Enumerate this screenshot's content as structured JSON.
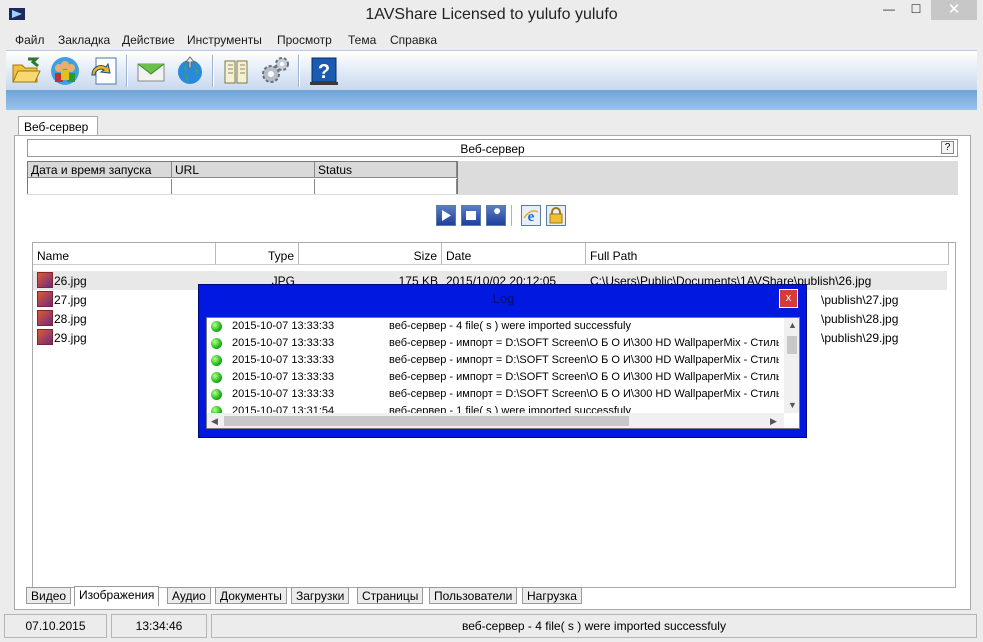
{
  "window": {
    "title": "1AVShare Licensed to yulufo yulufo",
    "min_glyph": "—",
    "max_glyph": "☐",
    "close_glyph": "✕"
  },
  "menu": [
    {
      "label": "Файл"
    },
    {
      "label": "Закладка"
    },
    {
      "label": "Действие"
    },
    {
      "label": "Инструменты"
    },
    {
      "label": "Просмотр"
    },
    {
      "label": "Тема"
    },
    {
      "label": "Справка"
    }
  ],
  "toolbar": {
    "icons": [
      "open-folder-icon",
      "users-icon",
      "share-doc-icon",
      "mail-icon",
      "globe-icon",
      "book-icon",
      "settings-gears-icon",
      "help-icon"
    ]
  },
  "main_tab": {
    "label": "Веб-сервер"
  },
  "web_server": {
    "header": "Веб-сервер",
    "help": "?",
    "columns": [
      "Дата и время запуска",
      "URL",
      "Status"
    ]
  },
  "controls": {
    "icons": [
      "play-icon",
      "stop-icon",
      "wrench-icon",
      "ie-icon",
      "lock-icon"
    ]
  },
  "file_list": {
    "columns": [
      "Name",
      "Type",
      "Size",
      "Date",
      "Full Path"
    ],
    "rows": [
      {
        "name": "26.jpg",
        "type": "JPG",
        "size": "175 KB",
        "date": "2015/10/02 20:12:05",
        "path": "C:\\Users\\Public\\Documents\\1AVShare\\publish\\26.jpg"
      },
      {
        "name": "27.jpg",
        "type": "",
        "size": "",
        "date": "",
        "path": "\\publish\\27.jpg"
      },
      {
        "name": "28.jpg",
        "type": "",
        "size": "",
        "date": "",
        "path": "\\publish\\28.jpg"
      },
      {
        "name": "29.jpg",
        "type": "",
        "size": "",
        "date": "",
        "path": "\\publish\\29.jpg"
      }
    ]
  },
  "bottom_tabs": [
    {
      "label": "Видео",
      "active": false
    },
    {
      "label": "Изображения",
      "active": true
    },
    {
      "label": "Аудио",
      "active": false
    },
    {
      "label": "Документы",
      "active": false
    },
    {
      "label": "Загрузки",
      "active": false
    },
    {
      "label": "Страницы",
      "active": false
    },
    {
      "label": "Пользователи",
      "active": false
    },
    {
      "label": "Нагрузка",
      "active": false
    }
  ],
  "status": {
    "date": "07.10.2015",
    "time": "13:34:46",
    "message": "веб-сервер - 4 file( s ) were imported successfuly"
  },
  "log": {
    "title": "Log",
    "close": "x",
    "entries": [
      {
        "time": "2015-10-07 13:33:33",
        "message": "веб-сервер - 4 file( s ) were imported successfuly"
      },
      {
        "time": "2015-10-07 13:33:33",
        "message": "веб-сервер - импорт = D:\\SOFT Screen\\О Б О И\\300 HD WallpaperMix - Стиль"
      },
      {
        "time": "2015-10-07 13:33:33",
        "message": "веб-сервер - импорт = D:\\SOFT Screen\\О Б О И\\300 HD WallpaperMix - Стиль"
      },
      {
        "time": "2015-10-07 13:33:33",
        "message": "веб-сервер - импорт = D:\\SOFT Screen\\О Б О И\\300 HD WallpaperMix - Стиль"
      },
      {
        "time": "2015-10-07 13:33:33",
        "message": "веб-сервер - импорт = D:\\SOFT Screen\\О Б О И\\300 HD WallpaperMix - Стиль"
      },
      {
        "time": "2015-10-07 13:31:54",
        "message": "веб-сервер - 1 file( s ) were imported successfuly"
      }
    ]
  }
}
